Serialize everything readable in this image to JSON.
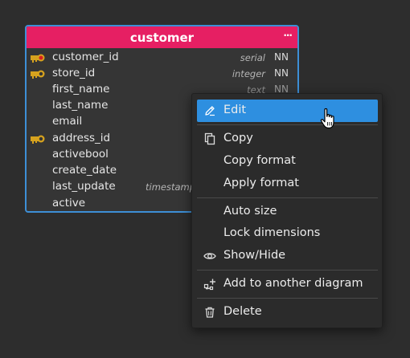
{
  "table": {
    "title": "customer",
    "menu_glyph": "···",
    "columns": [
      {
        "name": "customer_id",
        "type": "serial",
        "nn": "NN",
        "key": "primary"
      },
      {
        "name": "store_id",
        "type": "integer",
        "nn": "NN",
        "key": "foreign"
      },
      {
        "name": "first_name",
        "type": "text",
        "nn": "NN",
        "key": ""
      },
      {
        "name": "last_name",
        "type": "",
        "nn": "",
        "key": ""
      },
      {
        "name": "email",
        "type": "",
        "nn": "",
        "key": ""
      },
      {
        "name": "address_id",
        "type": "",
        "nn": "",
        "key": "foreign"
      },
      {
        "name": "activebool",
        "type": "",
        "nn": "",
        "key": ""
      },
      {
        "name": "create_date",
        "type": "",
        "nn": "",
        "key": ""
      },
      {
        "name": "last_update",
        "type": "timestamp",
        "nn": "",
        "key": ""
      },
      {
        "name": "active",
        "type": "",
        "nn": "",
        "key": ""
      }
    ],
    "colors": {
      "header": "#e61f63",
      "border": "#3d8fd6",
      "body": "#353535"
    }
  },
  "context_menu": {
    "items": [
      {
        "label": "Edit",
        "icon": "pencil-icon",
        "selected": true
      },
      {
        "label": "Copy",
        "icon": "copy-icon"
      },
      {
        "label": "Copy format",
        "icon": ""
      },
      {
        "label": "Apply format",
        "icon": ""
      },
      {
        "label": "Auto size",
        "icon": ""
      },
      {
        "label": "Lock dimensions",
        "icon": ""
      },
      {
        "label": "Show/Hide",
        "icon": "eye-icon"
      },
      {
        "label": "Add to another diagram",
        "icon": "add-to-diagram-icon"
      },
      {
        "label": "Delete",
        "icon": "trash-icon"
      }
    ],
    "selected_color": "#2e8fe0"
  },
  "cursor": {
    "icon": "hand-pointer-icon"
  }
}
